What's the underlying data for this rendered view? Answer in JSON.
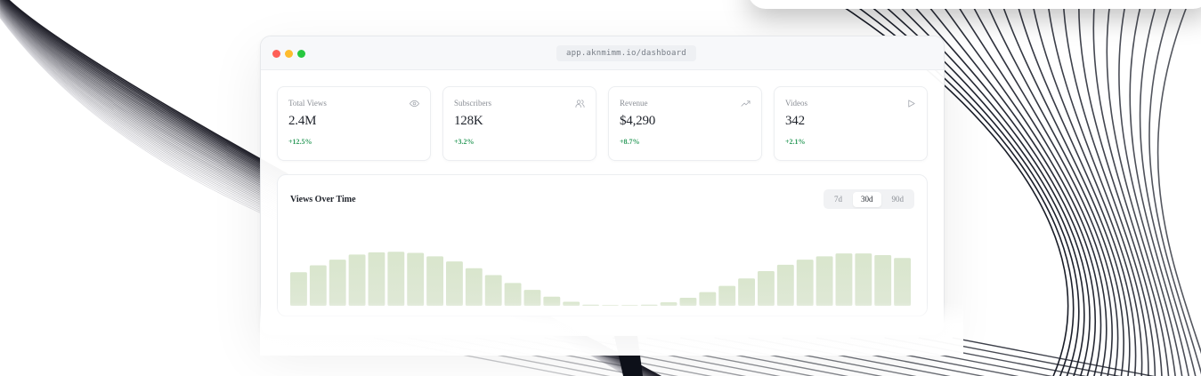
{
  "window": {
    "url": "app.aknmimm.io/dashboard"
  },
  "stats": [
    {
      "label": "Total Views",
      "value": "2.4M",
      "delta": "+12.5%",
      "icon": "eye-icon"
    },
    {
      "label": "Subscribers",
      "value": "128K",
      "delta": "+3.2%",
      "icon": "users-icon"
    },
    {
      "label": "Revenue",
      "value": "$4,290",
      "delta": "+8.7%",
      "icon": "trending-up-icon"
    },
    {
      "label": "Videos",
      "value": "342",
      "delta": "+2.1%",
      "icon": "play-icon"
    }
  ],
  "chart": {
    "title": "Views Over Time",
    "ranges": [
      "7d",
      "30d",
      "90d"
    ],
    "active_range": "30d",
    "bar_color": "#dfe8d6",
    "bar_color_top": "#d9e6cd",
    "max_value": 100,
    "values": [
      59,
      71,
      81,
      90,
      94,
      95,
      93,
      87,
      78,
      66,
      54,
      40,
      28,
      16,
      7,
      2,
      0,
      0,
      2,
      6,
      14,
      24,
      35,
      48,
      61,
      72,
      81,
      87,
      92,
      92,
      89,
      84
    ]
  },
  "colors": {
    "accent_positive": "#2e9b5c",
    "traffic_red": "#fe5f57",
    "traffic_yellow": "#febc2e",
    "traffic_green": "#28c840"
  }
}
